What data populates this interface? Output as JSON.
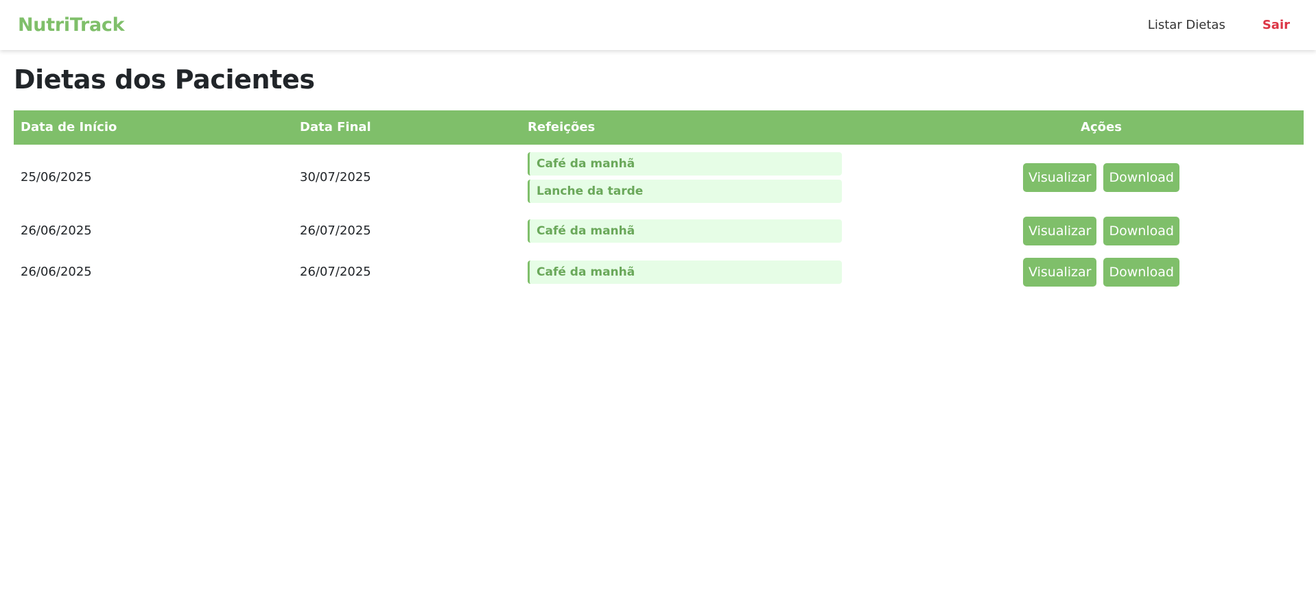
{
  "navbar": {
    "brand": "NutriTrack",
    "links": [
      {
        "label": "Listar Dietas"
      },
      {
        "label": "Sair"
      }
    ]
  },
  "page": {
    "title": "Dietas dos Pacientes"
  },
  "table": {
    "headers": [
      "Data de Início",
      "Data Final",
      "Refeições",
      "Ações"
    ],
    "rows": [
      {
        "start": "25/06/2025",
        "end": "30/07/2025",
        "meals": [
          "Café da manhã",
          "Lanche da tarde"
        ],
        "view_label": "Visualizar",
        "download_label": "Download"
      },
      {
        "start": "26/06/2025",
        "end": "26/07/2025",
        "meals": [
          "Café da manhã"
        ],
        "view_label": "Visualizar",
        "download_label": "Download"
      },
      {
        "start": "26/06/2025",
        "end": "26/07/2025",
        "meals": [
          "Café da manhã"
        ],
        "view_label": "Visualizar",
        "download_label": "Download"
      }
    ]
  },
  "colors": {
    "brand_green": "#7fbf6a",
    "meal_bg": "#e6fde6",
    "logout_red": "#dc3545"
  }
}
